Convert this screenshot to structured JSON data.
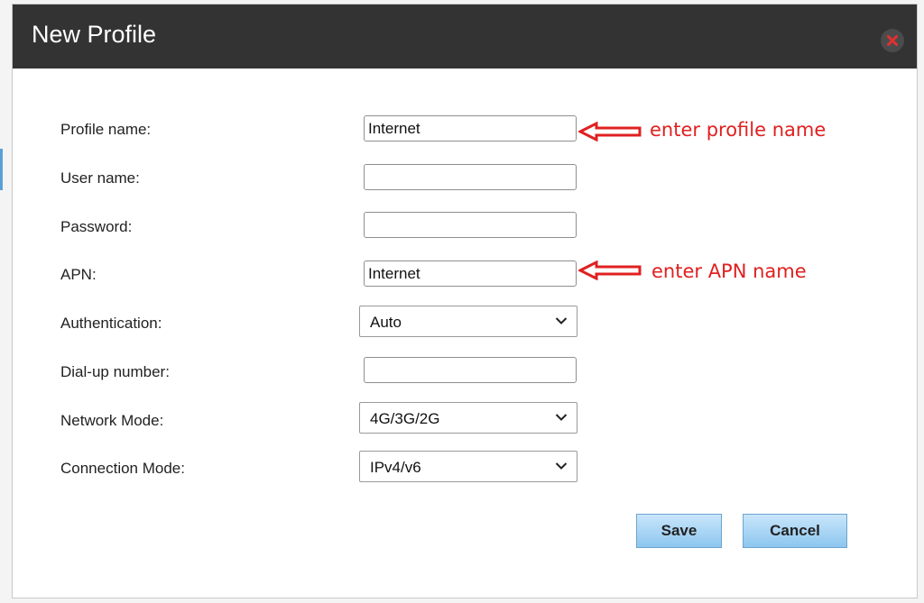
{
  "dialog": {
    "title": "New Profile",
    "close_icon": "close-icon"
  },
  "form": {
    "profile_name": {
      "label": "Profile name:",
      "value": "Internet"
    },
    "user_name": {
      "label": "User name:",
      "value": ""
    },
    "password": {
      "label": "Password:",
      "value": ""
    },
    "apn": {
      "label": "APN:",
      "value": "Internet"
    },
    "authentication": {
      "label": "Authentication:",
      "selected": "Auto"
    },
    "dialup": {
      "label": "Dial-up number:",
      "value": ""
    },
    "network_mode": {
      "label": "Network Mode:",
      "selected": "4G/3G/2G"
    },
    "connection_mode": {
      "label": "Connection Mode:",
      "selected": "IPv4/v6"
    }
  },
  "annotations": {
    "profile_name": "enter profile name",
    "apn": "enter APN name",
    "color": "#e02020"
  },
  "buttons": {
    "save": "Save",
    "cancel": "Cancel"
  }
}
